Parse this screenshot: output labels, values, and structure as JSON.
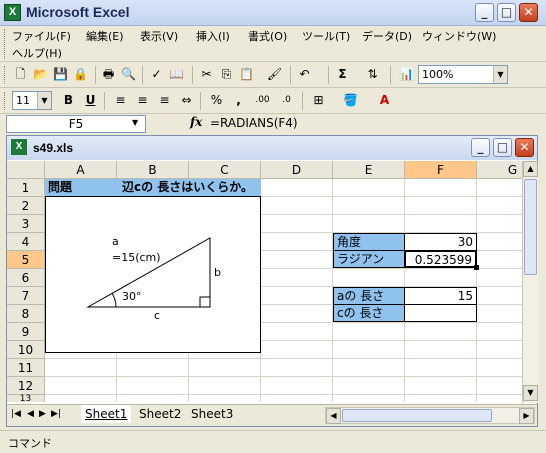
{
  "app": {
    "title": "Microsoft Excel",
    "icon_name": "excel-icon"
  },
  "menu": {
    "items": [
      "ファイル(F)",
      "編集(E)",
      "表示(V)",
      "挿入(I)",
      "書式(O)",
      "ツール(T)",
      "データ(D)",
      "ウィンドウ(W)",
      "ヘルプ(H)"
    ]
  },
  "toolbar": {
    "zoom": "100%",
    "font_size": "11"
  },
  "formula_bar": {
    "name_box": "F5",
    "fx_label": "fx",
    "formula": "=RADIANS(F4)"
  },
  "workbook": {
    "title": "s49.xls"
  },
  "grid": {
    "columns": [
      "A",
      "B",
      "C",
      "D",
      "E",
      "F",
      "G"
    ],
    "rows": [
      "1",
      "2",
      "3",
      "4",
      "5",
      "6",
      "7",
      "8",
      "9",
      "10",
      "11",
      "12",
      "13"
    ],
    "selected_cell": "F5",
    "a1": "問題",
    "b1": "辺cの 長さはいくらか。",
    "e4": "角度",
    "f4": "30",
    "e5": "ラジアン",
    "f5": "0.523599",
    "e7": "aの 長さ",
    "f7": "15",
    "e8": "cの 長さ",
    "f8": ""
  },
  "diagram": {
    "label_a": "a",
    "label_a_value": "=15(cm)",
    "label_b": "b",
    "label_c": "c",
    "label_angle": "30°"
  },
  "sheets": [
    "Sheet1",
    "Sheet2",
    "Sheet3"
  ],
  "active_sheet": "Sheet1",
  "status": {
    "text": "コマンド"
  },
  "colors": {
    "highlight": "#8fc3ee",
    "selected_header": "#ffc78a"
  }
}
